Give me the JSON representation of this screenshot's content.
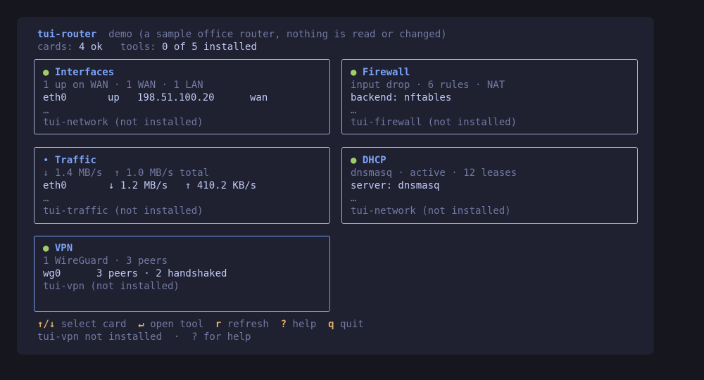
{
  "header": {
    "app_name": "tui-router",
    "description": "demo (a sample office router, nothing is read or changed)",
    "cards_label": "cards:",
    "cards_value": "4 ok",
    "tools_label": "tools:",
    "tools_value": "0 of 5 installed"
  },
  "cards": {
    "interfaces": {
      "status_glyph": "●",
      "title": "Interfaces",
      "summary": "1 up on WAN · 1 WAN · 1 LAN",
      "detail": [
        "eth0",
        "up",
        "198.51.100.20",
        "wan"
      ],
      "more": "…",
      "tool": "tui-network (not installed)"
    },
    "firewall": {
      "status_glyph": "●",
      "title": "Firewall",
      "summary": "input drop · 6 rules · NAT",
      "detail": "backend: nftables",
      "more": "…",
      "tool": "tui-firewall (not installed)"
    },
    "traffic": {
      "status_glyph": "•",
      "title": "Traffic",
      "summary": "↓ 1.4 MB/s  ↑ 1.0 MB/s total",
      "detail": [
        "eth0",
        "↓ 1.2 MB/s",
        "↑ 410.2 KB/s"
      ],
      "more": "…",
      "tool": "tui-traffic (not installed)"
    },
    "dhcp": {
      "status_glyph": "●",
      "title": "DHCP",
      "summary": "dnsmasq · active · 12 leases",
      "detail": "server: dnsmasq",
      "more": "…",
      "tool": "tui-network (not installed)"
    },
    "vpn": {
      "status_glyph": "●",
      "title": "VPN",
      "summary": "1 WireGuard · 3 peers",
      "detail": [
        "wg0",
        "3 peers · 2 handshaked"
      ],
      "tool": "tui-vpn (not installed)"
    }
  },
  "footer": {
    "hints": [
      {
        "key": "↑/↓",
        "label": "select card"
      },
      {
        "key": "↵",
        "label": "open tool"
      },
      {
        "key": "r",
        "label": "refresh"
      },
      {
        "key": "?",
        "label": "help"
      },
      {
        "key": "q",
        "label": "quit"
      }
    ],
    "status": "tui-vpn not installed  ·  ? for help"
  },
  "colors": {
    "background": "#16161e",
    "panel": "#1f2030",
    "accent": "#7aa2f7",
    "ok": "#9ece6a",
    "key": "#e0af68",
    "dim": "#737aa2"
  }
}
